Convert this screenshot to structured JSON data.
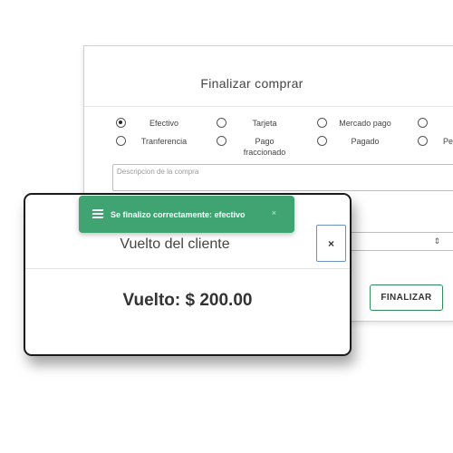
{
  "back_modal": {
    "title": "Finalizar comprar",
    "payment_options": [
      {
        "label": "Efectivo",
        "checked": true
      },
      {
        "label": "Tarjeta",
        "checked": false
      },
      {
        "label": "Mercado pago",
        "checked": false
      },
      {
        "label": "Tranferencia",
        "checked": false
      },
      {
        "label": "Pago\nfraccionado",
        "checked": false
      },
      {
        "label": "Pagado",
        "checked": false
      },
      {
        "label": "Pe",
        "checked": false
      }
    ],
    "description_placeholder": "Descripcion de la compra",
    "finalize_label": "FINALIZAR"
  },
  "front_modal": {
    "title": "Vuelto del cliente",
    "close_label": "×",
    "change_text": "Vuelto: $ 200.00"
  },
  "toast": {
    "message": "Se finalizo correctamente: efectivo",
    "close_label": "×"
  },
  "colors": {
    "toast_bg": "#3fa472",
    "finalize_border": "#2e8b57",
    "close_border": "#6d8fc8"
  }
}
